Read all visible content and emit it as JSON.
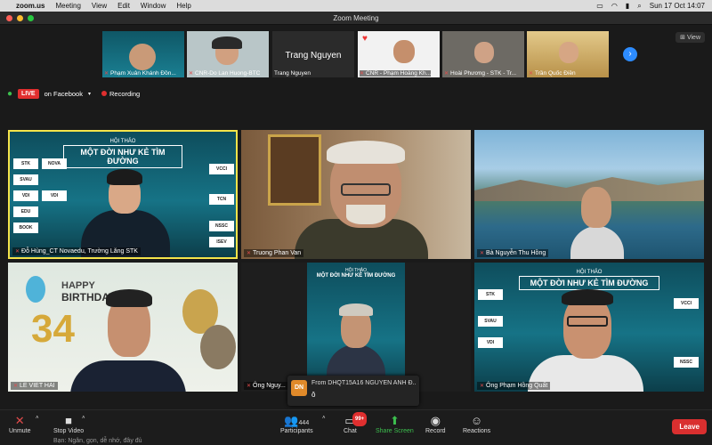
{
  "menubar": {
    "app": "zoom.us",
    "items": [
      "Meeting",
      "View",
      "Edit",
      "Window",
      "Help"
    ],
    "clock": "Sun 17 Oct  14:07"
  },
  "window": {
    "title": "Zoom Meeting"
  },
  "view_button": "View",
  "strip": [
    {
      "name": "Phạm Xuân Khánh Đồn...",
      "muted": true
    },
    {
      "name": "CNR-Do Lan Huong-BTC",
      "muted": true
    },
    {
      "name": "Trang Nguyen",
      "muted": false,
      "big_name": "Trang Nguyen"
    },
    {
      "name": "CNR - Phạm Hoàng Kh...",
      "muted": true
    },
    {
      "name": "Hoài Phương - STK - Tr...",
      "muted": true
    },
    {
      "name": "Trần Quốc Điền",
      "muted": true
    }
  ],
  "status": {
    "live": "LIVE",
    "live_on": "on Facebook",
    "recording": "Recording"
  },
  "tiles": [
    {
      "name": "Đỗ Hùng_CT Novaedu, Trường Lăng STK",
      "active": true
    },
    {
      "name": "Truong Phan Van"
    },
    {
      "name": "Bà Nguyễn Thu Hồng"
    },
    {
      "name": "LE VIET HAI"
    },
    {
      "name": "Ông Nguy..."
    },
    {
      "name": "Ông Phạm Hồng Quất"
    }
  ],
  "banner": {
    "hoi_thao": "HỘI THẢO",
    "title": "MỘT ĐỜI NHƯ KẺ TÌM ĐƯỜNG"
  },
  "birthday": {
    "happy": "HAPPY",
    "birthday": "BIRTHDAY",
    "number": "34"
  },
  "toolbar": {
    "unmute": "Unmute",
    "stop_video": "Stop Video",
    "participants": "Participants",
    "participants_count": "444",
    "chat": "Chat",
    "chat_badge": "99+",
    "share": "Share Screen",
    "record": "Record",
    "reactions": "Reactions",
    "leave": "Leave"
  },
  "chat_popup": {
    "initials": "DN",
    "from": "From DHQT15A16 NGUYỄN ANH Đ...",
    "message": "ô"
  },
  "bottom_text": "Bạn: Ngân, gọn, dễ nhớ, đây đủ"
}
